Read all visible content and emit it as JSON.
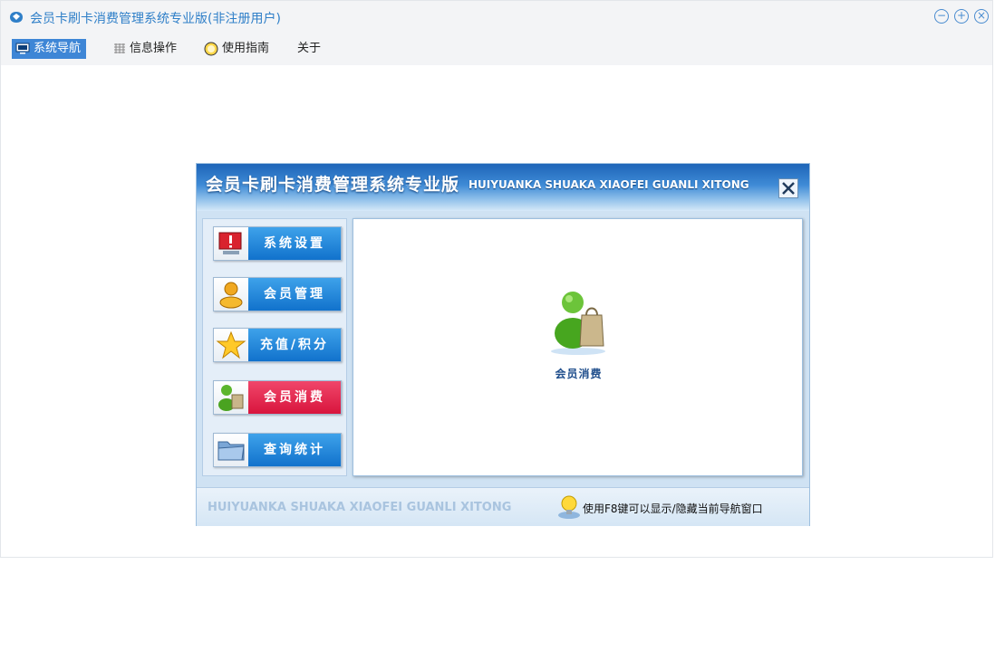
{
  "window": {
    "title": "会员卡刷卡消费管理系统专业版(非注册用户)",
    "controls": {
      "minimize": "−",
      "maximize": "+",
      "close": "×"
    }
  },
  "menu": {
    "items": [
      {
        "label": "系统导航",
        "icon": "monitor-icon",
        "active": true
      },
      {
        "label": "信息操作",
        "icon": "grid-icon",
        "active": false
      },
      {
        "label": "使用指南",
        "icon": "face-icon",
        "active": false
      },
      {
        "label": "关于",
        "icon": "",
        "active": false
      }
    ]
  },
  "dialog": {
    "title": "会员卡刷卡消费管理系统专业版",
    "subtitle": "HUIYUANKA SHUAKA XIAOFEI GUANLI XITONG",
    "nav_buttons": [
      {
        "label": "系统设置",
        "icon": "alert-monitor-icon",
        "selected": false
      },
      {
        "label": "会员管理",
        "icon": "user-icon",
        "selected": false
      },
      {
        "label": "充值/积分",
        "icon": "star-icon",
        "selected": false
      },
      {
        "label": "会员消费",
        "icon": "shopper-icon",
        "selected": true
      },
      {
        "label": "查询统计",
        "icon": "folder-icon",
        "selected": false
      }
    ],
    "content": {
      "item_label": "会员消费",
      "item_icon": "shopper-icon"
    },
    "footer": {
      "english": "HUIYUANKA SHUAKA XIAOFEI GUANLI XITONG",
      "tip": "使用F8键可以显示/隐藏当前导航窗口"
    }
  },
  "colors": {
    "accent": "#3e86d6",
    "title_blue": "#2f7fc8",
    "nav_blue": "#1172cc",
    "nav_selected_red": "#d8153d"
  }
}
